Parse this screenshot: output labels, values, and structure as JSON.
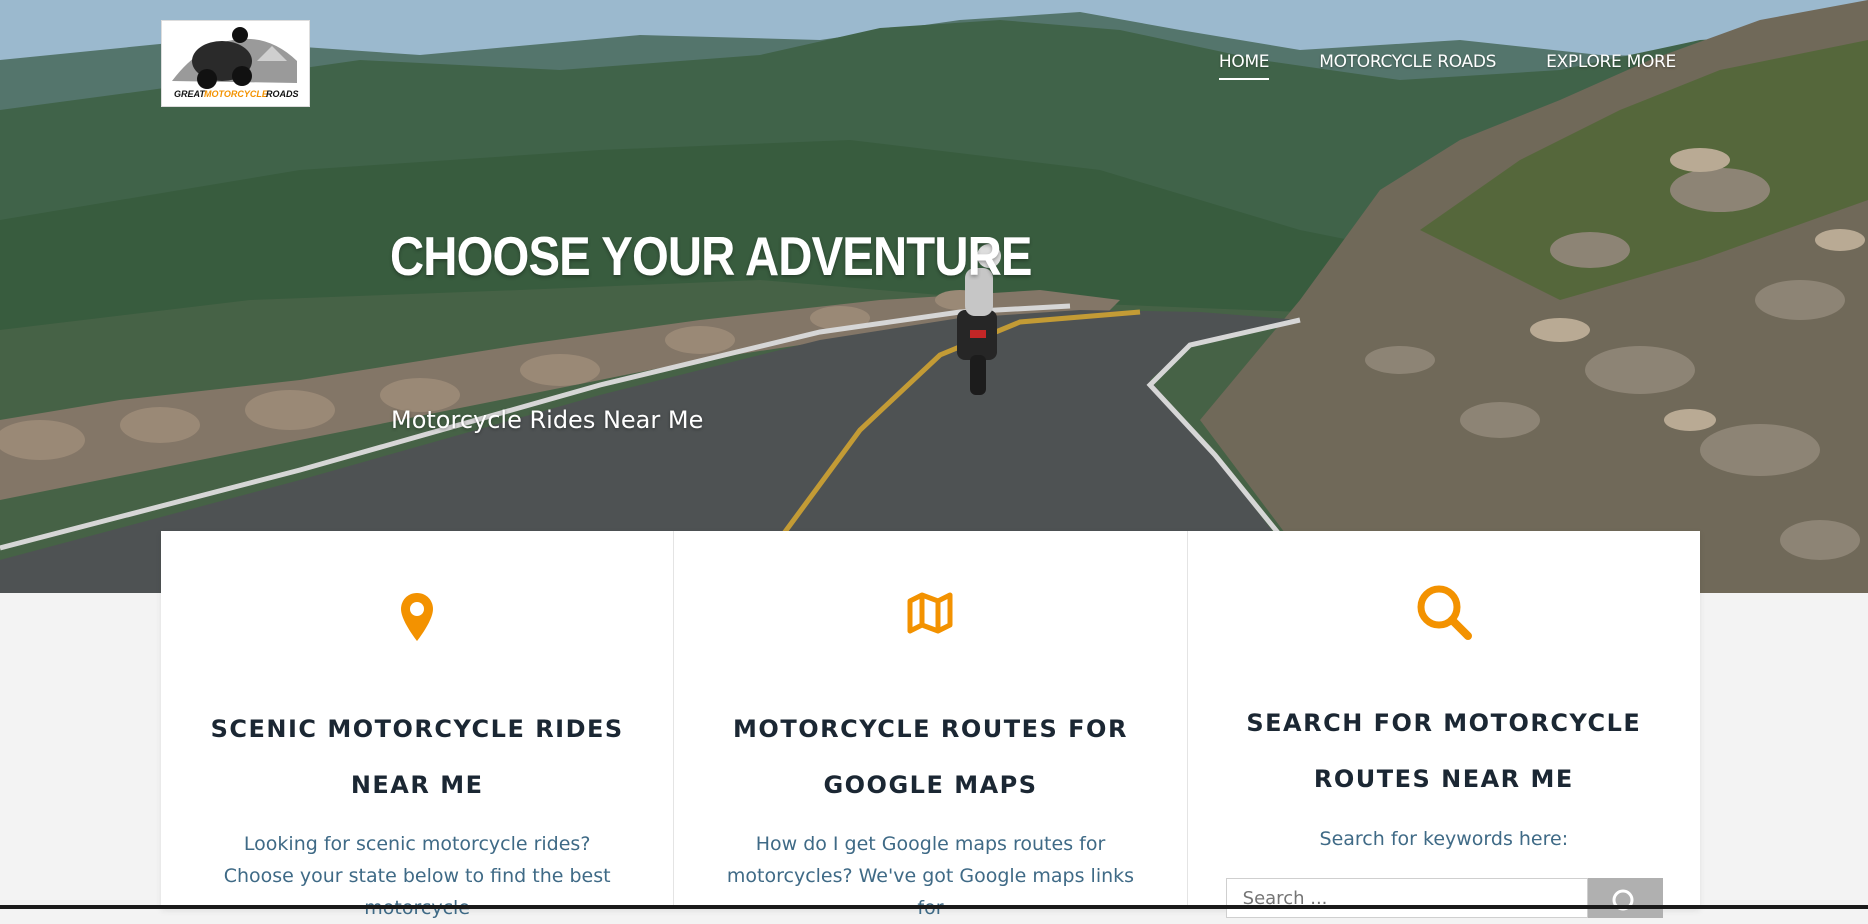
{
  "logo": {
    "alt": "Great Motorcycle Roads",
    "word_left": "GREAT",
    "word_mid": "MOTORCYCLE",
    "word_right": "ROADS",
    "accent_color": "#f39200"
  },
  "nav": {
    "items": [
      {
        "label": "HOME",
        "active": true
      },
      {
        "label": "MOTORCYCLE ROADS",
        "active": false
      },
      {
        "label": "EXPLORE MORE",
        "active": false
      }
    ]
  },
  "hero": {
    "title": "CHOOSE YOUR ADVENTURE",
    "subtitle": "Motorcycle Rides Near Me"
  },
  "cards": [
    {
      "icon": "map-marker-icon",
      "title": "SCENIC MOTORCYCLE RIDES NEAR ME",
      "text": "Looking for scenic motorcycle rides? Choose your state below to find the best motorcycle"
    },
    {
      "icon": "folded-map-icon",
      "title": "MOTORCYCLE ROUTES FOR GOOGLE MAPS",
      "text": "How do I get Google maps routes for motorcycles? We've got Google maps links for"
    },
    {
      "icon": "search-icon",
      "title": "SEARCH FOR MOTORCYCLE ROUTES NEAR ME",
      "search_label": "Search for keywords here:",
      "search_placeholder": "Search ..."
    }
  ],
  "colors": {
    "accent": "#f39200",
    "heading": "#1b2733",
    "body_text": "#3f6a86",
    "card_bg": "#ffffff",
    "page_bg": "#f3f3f3"
  }
}
